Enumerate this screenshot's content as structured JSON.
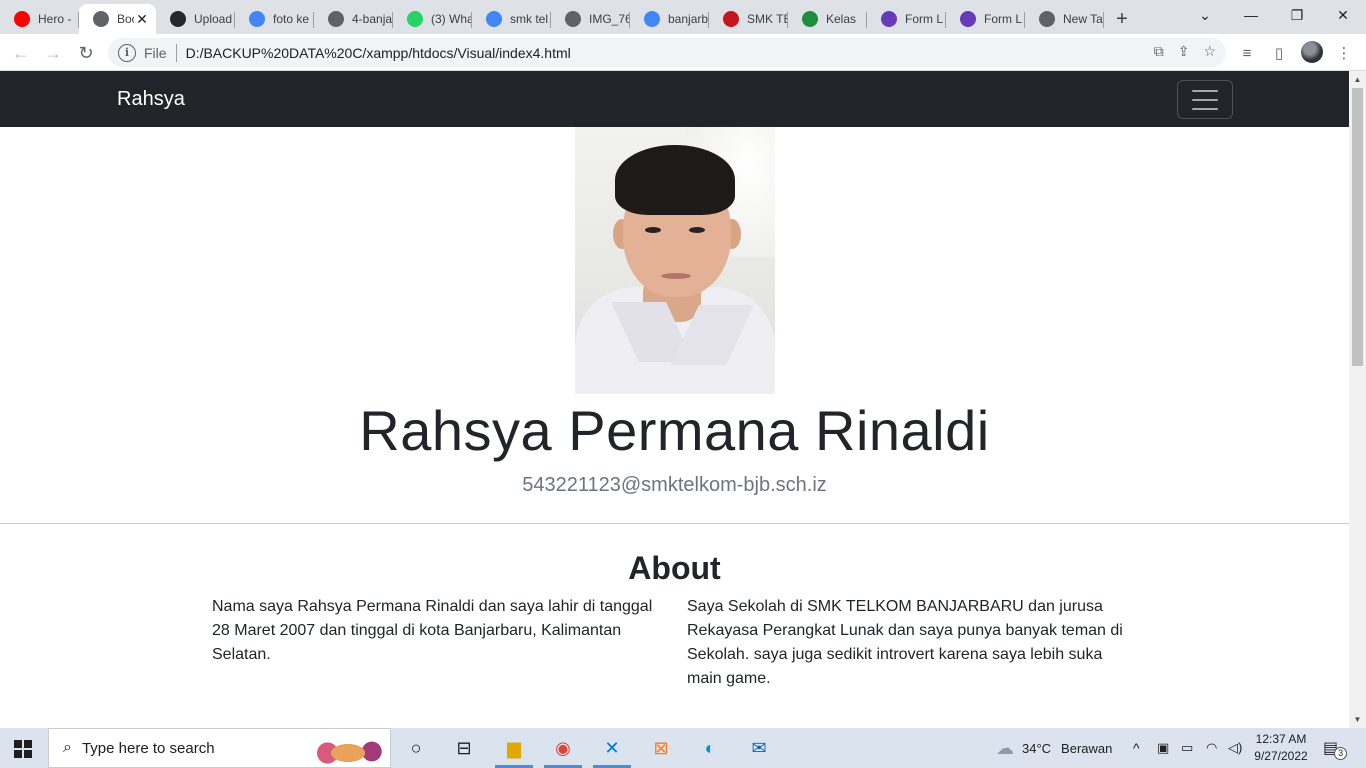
{
  "browser": {
    "tabs": [
      {
        "title": "Hero -",
        "icon": "youtube-icon",
        "color": "#ff0000"
      },
      {
        "title": "Boo",
        "icon": "globe-icon",
        "color": "#5f6368",
        "active": true
      },
      {
        "title": "Upload",
        "icon": "github-icon",
        "color": "#24292e"
      },
      {
        "title": "foto ke",
        "icon": "google-icon",
        "color": "#4285f4"
      },
      {
        "title": "4-banja",
        "icon": "globe-icon",
        "color": "#5f6368"
      },
      {
        "title": "(3) Wha",
        "icon": "whatsapp-icon",
        "color": "#25d366"
      },
      {
        "title": "smk tel",
        "icon": "google-icon",
        "color": "#4285f4"
      },
      {
        "title": "IMG_76",
        "icon": "globe-icon",
        "color": "#5f6368"
      },
      {
        "title": "banjarb",
        "icon": "google-icon",
        "color": "#4285f4"
      },
      {
        "title": "SMK TE",
        "icon": "smk-telkom-icon",
        "color": "#c4161c"
      },
      {
        "title": "Kelas",
        "icon": "classroom-icon",
        "color": "#1e8e3e"
      },
      {
        "title": "Form L",
        "icon": "forms-icon",
        "color": "#673ab7"
      },
      {
        "title": "Form L",
        "icon": "forms-icon",
        "color": "#673ab7"
      },
      {
        "title": "New Ta",
        "icon": "chrome-icon",
        "color": "#5f6368"
      }
    ],
    "address": {
      "scheme_label": "File",
      "url": "D:/BACKUP%20DATA%20C/xampp/htdocs/Visual/index4.html"
    }
  },
  "page": {
    "brand": "Rahsya",
    "name": "Rahsya Permana Rinaldi",
    "email": "543221123@smktelkom-bjb.sch.iz",
    "about": {
      "title": "About",
      "left": "Nama saya Rahsya Permana Rinaldi dan saya lahir di tanggal 28 Maret 2007 dan tinggal di kota Banjarbaru, Kalimantan Selatan.",
      "right": "Saya Sekolah di SMK TELKOM BANJARBARU dan jurusa Rekayasa Perangkat Lunak dan saya punya banyak teman di Sekolah. saya juga sedikit introvert karena saya lebih suka main game."
    }
  },
  "taskbar": {
    "search_placeholder": "Type here to search",
    "weather_temp": "34°C",
    "weather_text": "Berawan",
    "time": "12:37 AM",
    "date": "9/27/2022",
    "notification_count": "3"
  },
  "colors": {
    "navbar": "#212529",
    "tabstrip": "#dee1e6",
    "taskbar": "#dbe3ee"
  }
}
